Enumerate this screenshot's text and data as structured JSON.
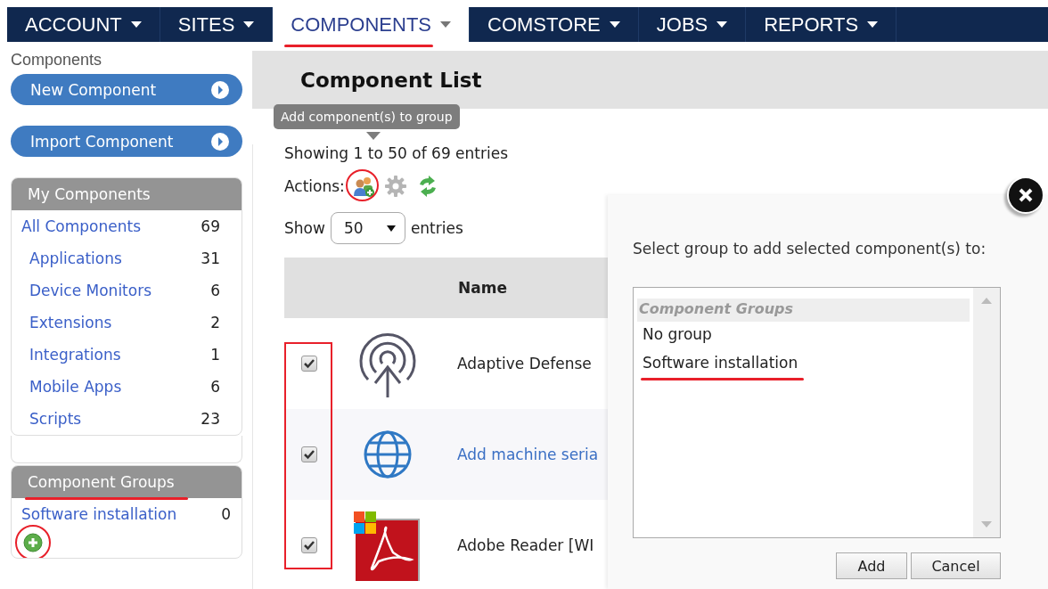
{
  "nav": [
    {
      "label": "ACCOUNT",
      "selected": false,
      "annotated": false
    },
    {
      "label": "SITES",
      "selected": false,
      "annotated": false
    },
    {
      "label": "COMPONENTS",
      "selected": true,
      "annotated": true
    },
    {
      "label": "COMSTORE",
      "selected": false,
      "annotated": false
    },
    {
      "label": "JOBS",
      "selected": false,
      "annotated": false
    },
    {
      "label": "REPORTS",
      "selected": false,
      "annotated": false
    }
  ],
  "sidebar": {
    "title": "Components",
    "buttons": [
      "New Component",
      "Import Component"
    ],
    "my_components": {
      "title": "My Components",
      "items": [
        {
          "label": "All Components",
          "count": "69",
          "children": [
            {
              "label": "Applications",
              "count": "31"
            },
            {
              "label": "Device Monitors",
              "count": "6"
            },
            {
              "label": "Extensions",
              "count": "2"
            },
            {
              "label": "Integrations",
              "count": "1"
            },
            {
              "label": "Mobile Apps",
              "count": "6"
            },
            {
              "label": "Scripts",
              "count": "23"
            }
          ]
        }
      ]
    },
    "component_groups": {
      "title": "Component Groups",
      "annotated": true,
      "add_annotated": true,
      "items": [
        {
          "label": "Software installation",
          "count": "0"
        }
      ]
    }
  },
  "main": {
    "title": "Component List",
    "tooltip": "Add component(s) to group",
    "info": "Showing 1 to 50 of 69 entries",
    "actions_label": "Actions:",
    "actions": [
      {
        "kind": "add-to-group",
        "annotated": true
      },
      {
        "kind": "settings",
        "annotated": false
      },
      {
        "kind": "refresh",
        "annotated": false
      }
    ],
    "show_label": "Show",
    "page_size": "50",
    "entries_label": "entries",
    "table": {
      "columns": [
        "Name"
      ],
      "checkbox_column_annotated": true,
      "rows": [
        {
          "kind": "antenna",
          "name": "Adaptive Defense",
          "link": false,
          "checked": true
        },
        {
          "kind": "globe",
          "name": "Add machine seria",
          "link": true,
          "checked": true
        },
        {
          "kind": "reader",
          "name": "Adobe Reader [WI",
          "link": false,
          "checked": true
        }
      ]
    }
  },
  "dialog": {
    "prompt": "Select group to add selected component(s) to:",
    "list_header": "Component Groups",
    "options": [
      {
        "label": "No group",
        "selected": false,
        "annotated": false
      },
      {
        "label": "Software installation",
        "selected": false,
        "annotated": true
      }
    ],
    "buttons": [
      "Add",
      "Cancel"
    ]
  }
}
